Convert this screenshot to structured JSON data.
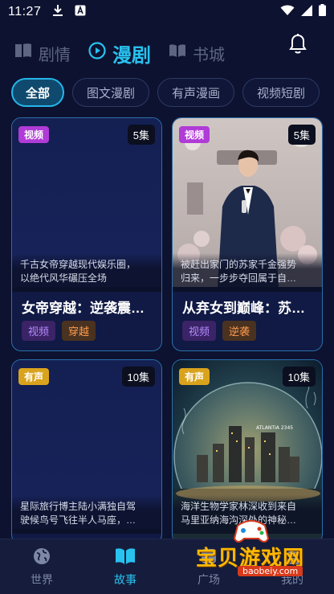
{
  "status_bar": {
    "time": "11:27"
  },
  "header": {
    "tabs": [
      {
        "label": "剧情",
        "icon": "book-icon",
        "active": false
      },
      {
        "label": "漫剧",
        "icon": "play-circle-icon",
        "active": true
      },
      {
        "label": "书城",
        "icon": "book-open-icon",
        "active": false
      }
    ],
    "bell_icon": "bell-icon"
  },
  "filters": [
    {
      "label": "全部",
      "active": true
    },
    {
      "label": "图文漫剧",
      "active": false
    },
    {
      "label": "有声漫画",
      "active": false
    },
    {
      "label": "视频短剧",
      "active": false
    }
  ],
  "cards": [
    {
      "type": "视频",
      "type_color": "#b03bd6",
      "count": "5集",
      "desc_lines": [
        "千古女帝穿越现代娱乐圈，",
        "以绝代风华碾压全场"
      ],
      "title": "女帝穿越：逆袭震…",
      "tags": [
        {
          "label": "视频",
          "style": "purple"
        },
        {
          "label": "穿越",
          "style": "orange"
        }
      ]
    },
    {
      "type": "视频",
      "type_color": "#b03bd6",
      "count": "5集",
      "desc_lines": [
        "被赶出家门的苏家千金强势",
        "归来，一步步夺回属于自…"
      ],
      "title": "从弃女到巅峰：苏…",
      "tags": [
        {
          "label": "视频",
          "style": "purple"
        },
        {
          "label": "逆袭",
          "style": "orange"
        }
      ]
    },
    {
      "type": "有声",
      "type_color": "#d9a31d",
      "count": "10集",
      "desc_lines": [
        "星际旅行博主陆小满独自驾",
        "驶候鸟号飞往半人马座，…"
      ],
      "title": "",
      "tags": []
    },
    {
      "type": "有声",
      "type_color": "#d9a31d",
      "count": "10集",
      "desc_lines": [
        "海洋生物学家林深收到来自",
        "马里亚纳海沟深处的神秘…"
      ],
      "title": "",
      "tags": [],
      "image_text": "ATLANTIA 2345"
    }
  ],
  "bottom_nav": [
    {
      "label": "世界",
      "icon": "globe-icon",
      "active": false
    },
    {
      "label": "故事",
      "icon": "book-open-icon",
      "active": true
    },
    {
      "label": "广场",
      "icon": "square-icon",
      "active": false
    },
    {
      "label": "我的",
      "icon": "user-icon",
      "active": false
    }
  ],
  "watermark": {
    "text": "宝贝游戏网",
    "url": "baobeiy.com"
  }
}
